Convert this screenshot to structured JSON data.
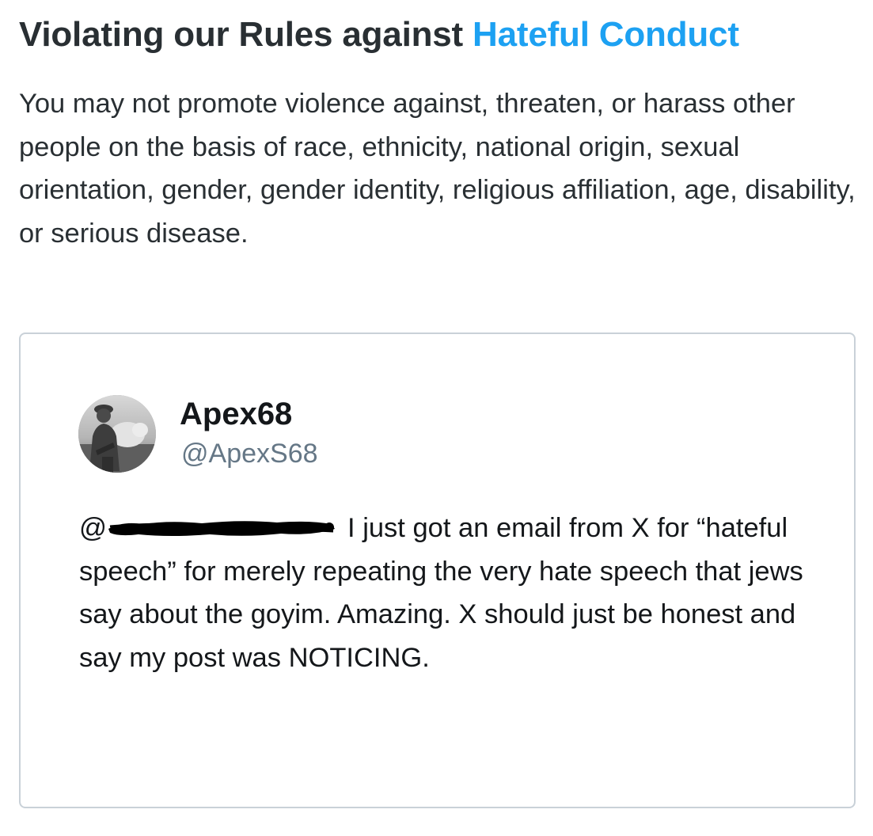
{
  "heading": {
    "prefix": "Violating our Rules against ",
    "link": "Hateful Conduct"
  },
  "rule_text": "You may not promote violence against, threaten, or harass other people on the basis of race, ethnicity, national origin, sexual orientation, gender, gender identity, religious affiliation, age, disability, or serious disease.",
  "tweet": {
    "display_name": "Apex68",
    "handle": "@ApexS68",
    "mention_prefix": "@",
    "body": "I just got an email from X for “hateful speech” for merely repeating the very hate speech that jews say about the goyim. Amazing. X should just be honest and say my post was NOTICING."
  },
  "colors": {
    "link": "#1da1f2",
    "heading_text": "#292f33",
    "handle": "#657786",
    "card_border": "#c9d1d8"
  }
}
